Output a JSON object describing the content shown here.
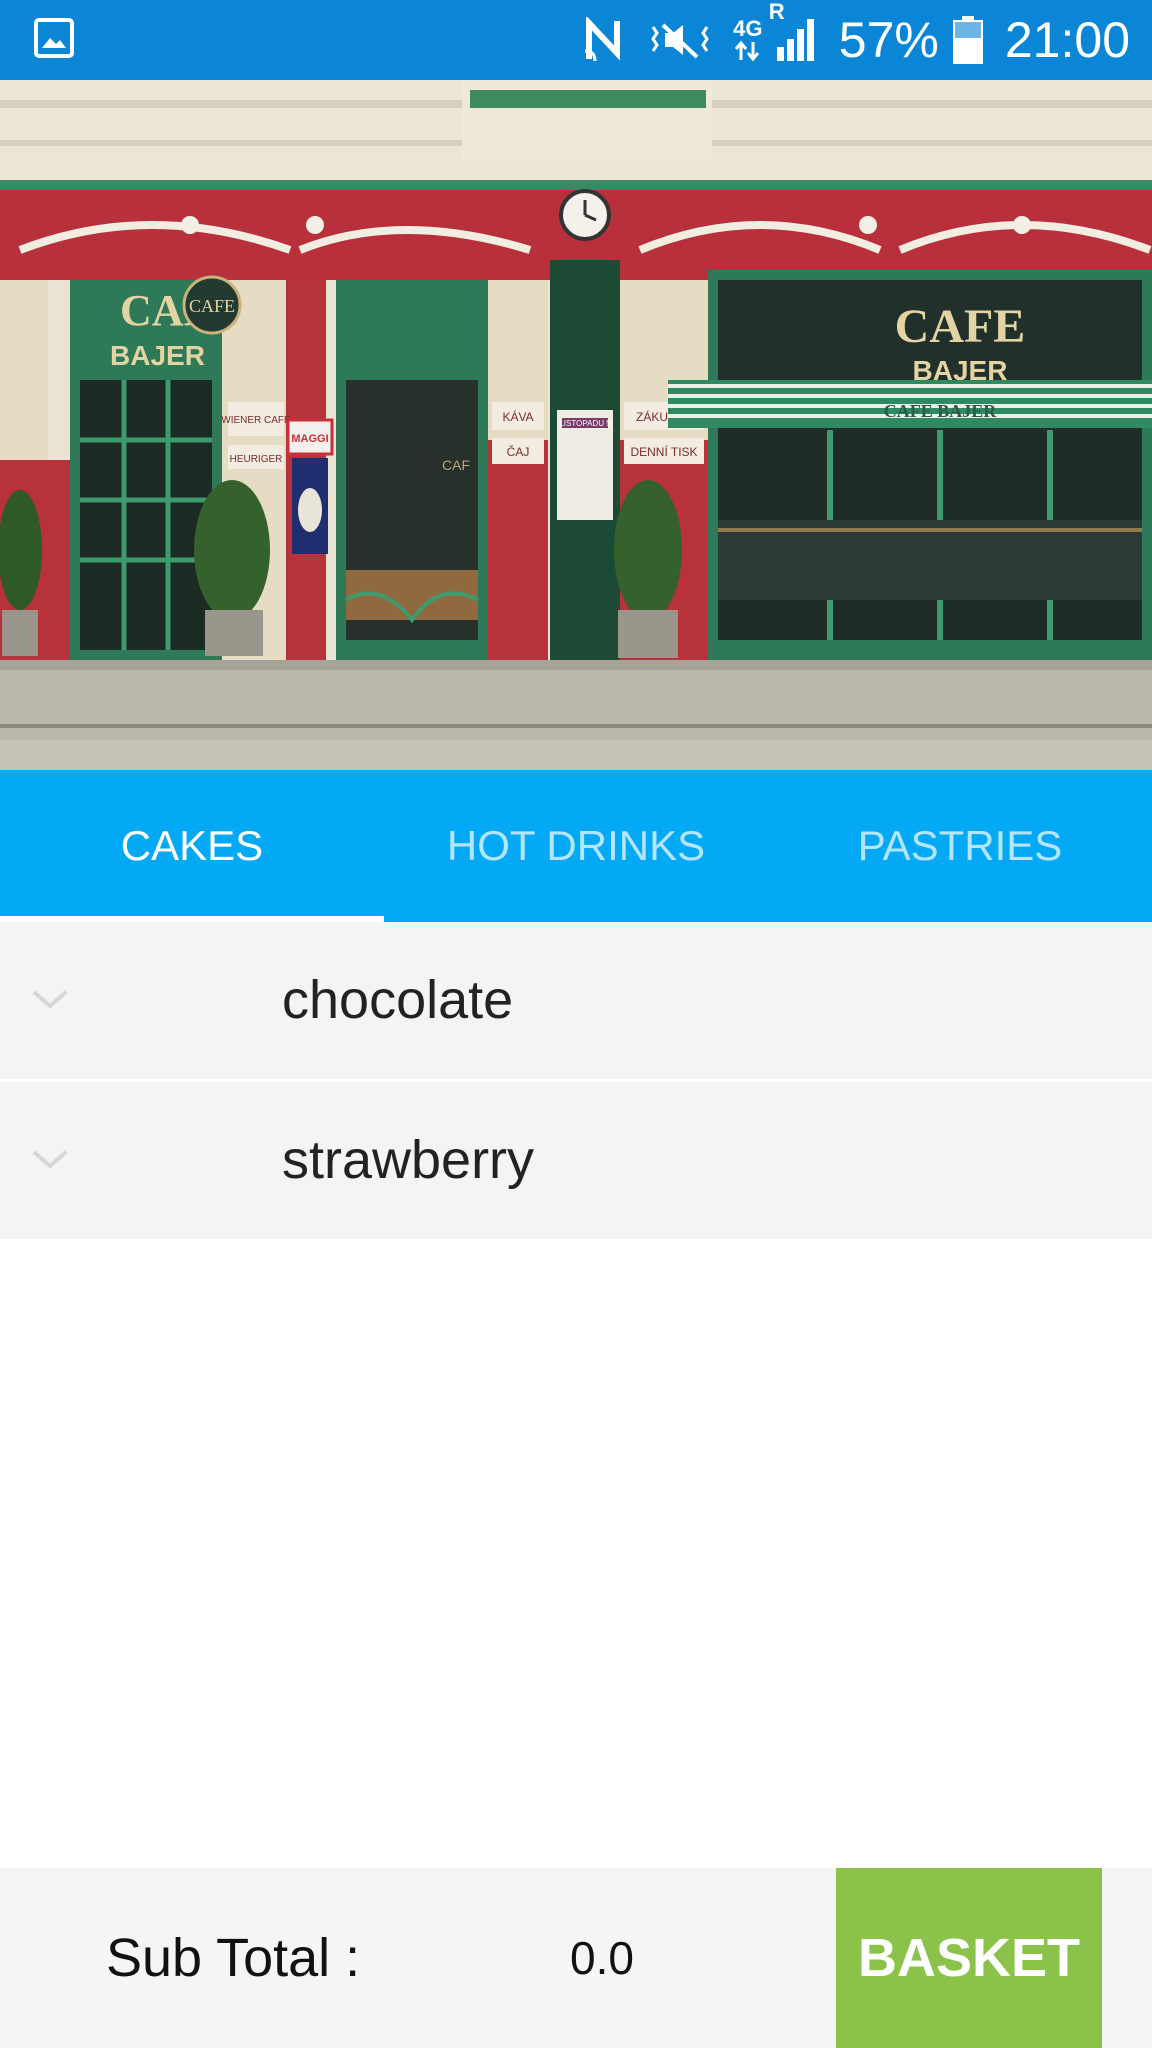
{
  "status_bar": {
    "battery_percent": "57%",
    "time": "21:00",
    "network_label": "4G",
    "roaming_label": "R",
    "icons": [
      "gallery-icon",
      "nfc-icon",
      "vibrate-icon",
      "network-4g-icon",
      "signal-icon",
      "battery-icon"
    ]
  },
  "hero": {
    "sign_left_1": "CAFE",
    "sign_left_2": "BAJER",
    "round_sign": "CAFE",
    "sign_right_1": "CAFE",
    "sign_right_2": "BAJER",
    "awning_text": "CAFE BAJER",
    "panel_wiener": "WIENER CAFE",
    "panel_heuriger": "HEURIGER",
    "panel_kava": "KÁVA",
    "panel_caj": "ČAJ",
    "panel_zakusky": "ZÁKUSKY",
    "panel_denni_tisk": "DENNÍ TISK",
    "maggi": "MAGGI",
    "street_sign": "LISTOPADU 5",
    "door_text": "CAF"
  },
  "tabs": [
    {
      "label": "CAKES",
      "active": true
    },
    {
      "label": "HOT DRINKS",
      "active": false
    },
    {
      "label": "PASTRIES",
      "active": false
    }
  ],
  "items": [
    {
      "label": "chocolate"
    },
    {
      "label": "strawberry"
    }
  ],
  "footer": {
    "subtotal_label": "Sub Total :",
    "subtotal_value": "0.0",
    "basket_label": "BASKET"
  },
  "colors": {
    "status_bar": "#0b86d6",
    "tab_bar": "#03a9f4",
    "basket": "#8bc34a",
    "list_bg": "#f4f4f4"
  }
}
